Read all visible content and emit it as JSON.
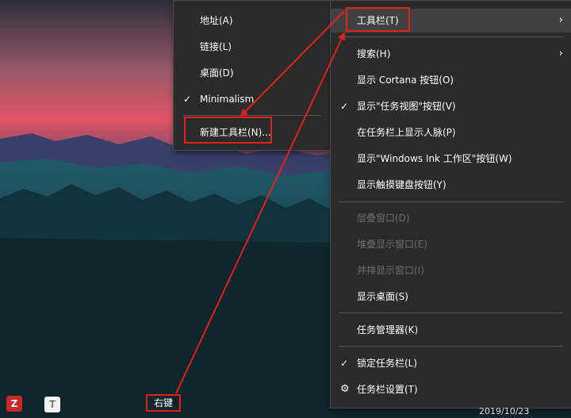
{
  "toolbar_submenu": {
    "items": [
      {
        "label": "地址(A)",
        "checked": false
      },
      {
        "label": "链接(L)",
        "checked": false
      },
      {
        "label": "桌面(D)",
        "checked": false
      },
      {
        "label": "Minimalism",
        "checked": true
      }
    ],
    "new_toolbar_label": "新建工具栏(N)..."
  },
  "taskbar_menu": {
    "toolbars_label": "工具栏(T)",
    "items": [
      {
        "label": "搜索(H)",
        "checked": false,
        "submenu": true,
        "enabled": true
      },
      {
        "label": "显示 Cortana 按钮(O)",
        "checked": false,
        "enabled": true
      },
      {
        "label": "显示\"任务视图\"按钮(V)",
        "checked": true,
        "enabled": true
      },
      {
        "label": "在任务栏上显示人脉(P)",
        "checked": false,
        "enabled": true
      },
      {
        "label": "显示\"Windows Ink 工作区\"按钮(W)",
        "checked": false,
        "enabled": true
      },
      {
        "label": "显示触摸键盘按钮(Y)",
        "checked": false,
        "enabled": true
      }
    ],
    "window_items": [
      {
        "label": "层叠窗口(D)",
        "enabled": false
      },
      {
        "label": "堆叠显示窗口(E)",
        "enabled": false
      },
      {
        "label": "并排显示窗口(I)",
        "enabled": false
      },
      {
        "label": "显示桌面(S)",
        "enabled": true
      }
    ],
    "task_manager_label": "任务管理器(K)",
    "lock_taskbar_label": "锁定任务栏(L)",
    "lock_taskbar_checked": true,
    "settings_label": "任务栏设置(T)"
  },
  "annotation": {
    "right_click_label": "右键",
    "color": "#e02020"
  },
  "taskbar": {
    "clock_date": "2019/10/23",
    "icons": [
      "zotero-icon",
      "typora-icon"
    ],
    "zotero_glyph": "Z",
    "typora_glyph": "T"
  },
  "glyphs": {
    "check": "✓",
    "chevron": "›",
    "gear": "⚙"
  }
}
